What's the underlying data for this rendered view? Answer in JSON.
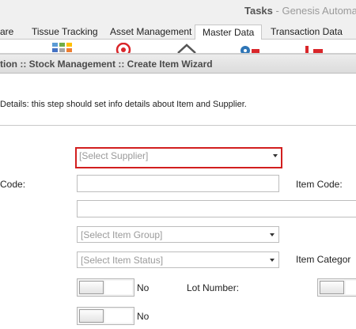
{
  "window": {
    "title_main": "Tasks",
    "title_sep": " - ",
    "title_app": "Genesis Automat"
  },
  "tabs": [
    {
      "label": "are"
    },
    {
      "label": "Tissue Tracking"
    },
    {
      "label": "Asset Management"
    },
    {
      "label": "Master Data",
      "active": true
    },
    {
      "label": "Transaction Data"
    }
  ],
  "breadcrumb": "tion :: Stock Management :: Create Item Wizard",
  "description": "Details: this step should set info details about Item and Supplier.",
  "form": {
    "supplier_select": {
      "placeholder": "[Select Supplier]"
    },
    "code_label": "Code:",
    "item_code_label": "Item Code:",
    "item_group_select": {
      "placeholder": "[Select Item Group]"
    },
    "item_status_select": {
      "placeholder": "[Select Item Status]"
    },
    "item_category_label": "Item Categor",
    "toggle1_label": "No",
    "lot_number_label": "Lot Number:",
    "toggle2_label": "No"
  },
  "colors": {
    "highlight_border": "#d21f1f",
    "breadcrumb_text": "#4a4a4a",
    "placeholder_text": "#9a9a9a"
  },
  "ribbon_icons": [
    "grid-icon",
    "target-icon",
    "home-icon",
    "location-icon",
    "cart-icon"
  ]
}
